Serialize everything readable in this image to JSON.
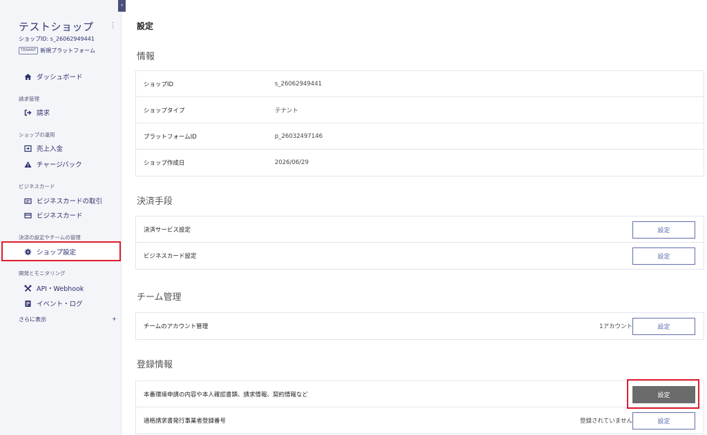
{
  "sidebar": {
    "collapse_glyph": "‹",
    "shop_name": "テストショップ",
    "menu_glyph": "⋮",
    "shop_id": "ショップID: s_26062949441",
    "tenant_badge": "TENANT",
    "tenant_text": "新規プラットフォーム",
    "dashboard": "ダッシュボード",
    "billing_section": "請求管理",
    "billing": "請求",
    "operations_section": "ショップの運用",
    "sales": "売上入金",
    "chargeback": "チャージバック",
    "bizcard_section": "ビジネスカード",
    "bizcard_tx": "ビジネスカードの取引",
    "bizcard": "ビジネスカード",
    "settings_section": "決済の設定やチームの管理",
    "shop_settings": "ショップ設定",
    "dev_section": "開発とモニタリング",
    "api": "API・Webhook",
    "event_log": "イベント・ログ",
    "more": "さらに表示",
    "more_glyph": "+"
  },
  "main": {
    "title": "設定",
    "info": {
      "title": "情報",
      "rows": [
        {
          "label": "ショップID",
          "value": "s_26062949441"
        },
        {
          "label": "ショップタイプ",
          "value": "テナント"
        },
        {
          "label": "プラットフォームID",
          "value": "p_26032497146"
        },
        {
          "label": "ショップ作成日",
          "value": "2026/06/29"
        }
      ]
    },
    "payment": {
      "title": "決済手段",
      "rows": [
        {
          "label": "決済サービス設定",
          "button": "設定"
        },
        {
          "label": "ビジネスカード設定",
          "button": "設定"
        }
      ]
    },
    "team": {
      "title": "チーム管理",
      "rows": [
        {
          "label": "チームのアカウント管理",
          "side": "1アカウント",
          "button": "設定"
        }
      ]
    },
    "registration": {
      "title": "登録情報",
      "rows": [
        {
          "label": "本番環境申請の内容や本人確認書類、請求情報、契約情報など",
          "button": "設定"
        },
        {
          "label": "適格請求書発行事業者登録番号",
          "side": "登録されていません",
          "button": "設定"
        }
      ]
    }
  },
  "colors": {
    "accent": "#5b6bb0",
    "highlight": "#e0192b",
    "dark_button": "#6b6b6b"
  }
}
